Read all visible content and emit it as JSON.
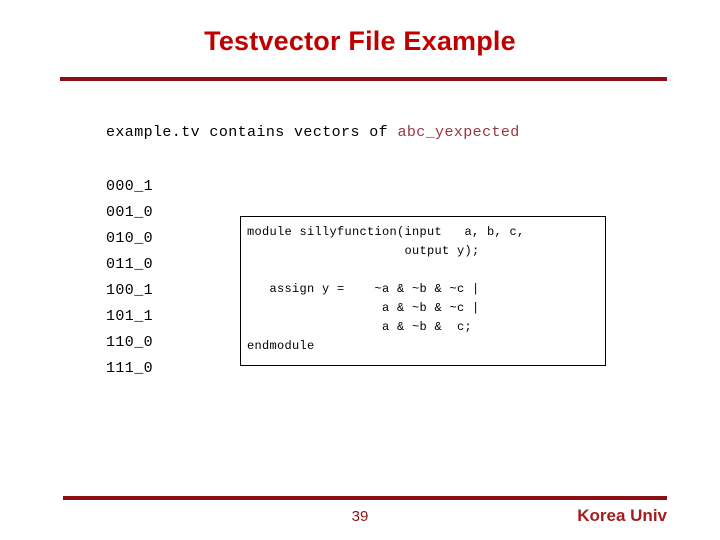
{
  "slide": {
    "title": "Testvector File Example",
    "accent_color": "#c00000",
    "rule_color": "#8b1013"
  },
  "subtitle": {
    "prefix": "example.tv contains vectors of ",
    "accent": "abc_yexpected",
    "accent_color": "#993344"
  },
  "testvectors": {
    "items": [
      "000_1",
      "001_0",
      "010_0",
      "011_0",
      "100_1",
      "101_1",
      "110_0",
      "111_0"
    ]
  },
  "code_box": {
    "language": "verilog",
    "text": "module sillyfunction(input   a, b, c,\n                     output y);\n\n   assign y =    ~a & ~b & ~c |\n                  a & ~b & ~c |\n                  a & ~b &  c;\nendmodule"
  },
  "footer": {
    "page_number": "39",
    "brand": "Korea Univ",
    "brand_color": "#a51c1c"
  }
}
